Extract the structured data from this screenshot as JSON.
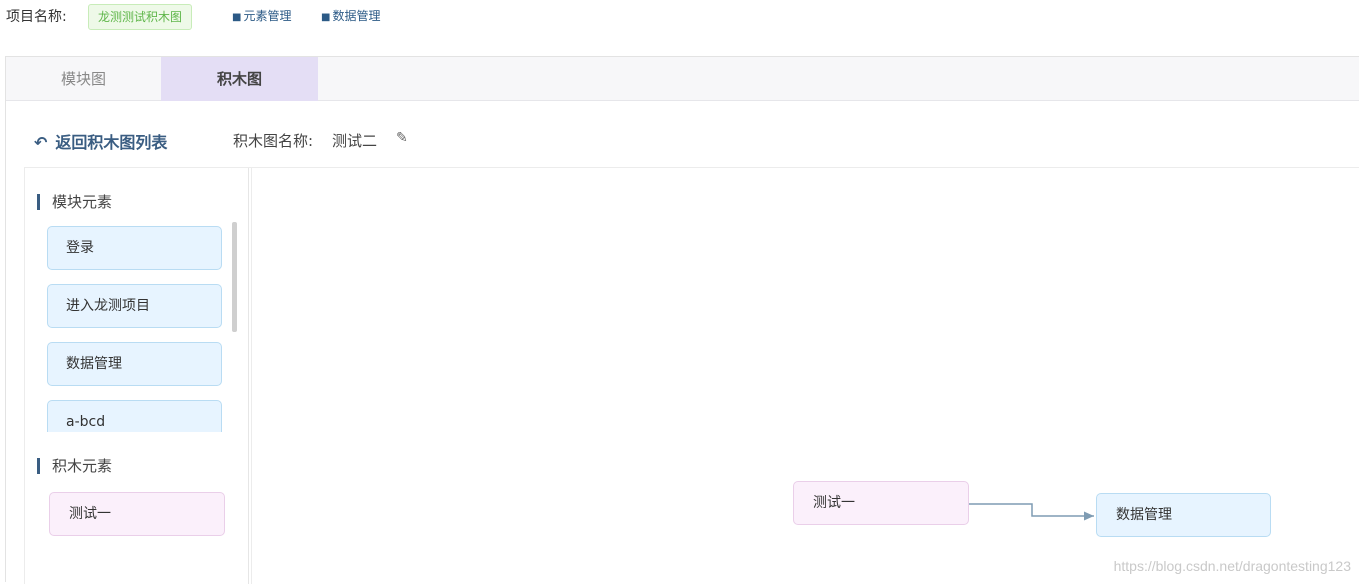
{
  "header": {
    "project_label": "项目名称:",
    "project_name": "龙测测试积木图",
    "links": [
      {
        "label": "元素管理",
        "icon": "puzzle-icon"
      },
      {
        "label": "数据管理",
        "icon": "puzzle-icon"
      }
    ]
  },
  "tabs": [
    {
      "label": "模块图",
      "active": false
    },
    {
      "label": "积木图",
      "active": true
    }
  ],
  "toolbar": {
    "back_label": "返回积木图列表",
    "name_label": "积木图名称:",
    "name_value": "测试二"
  },
  "sidebar": {
    "module_title": "模块元素",
    "modules": [
      "登录",
      "进入龙测项目",
      "数据管理",
      "a-bcd"
    ],
    "block_title": "积木元素",
    "blocks": [
      "测试一"
    ]
  },
  "canvas": {
    "nodes": [
      {
        "label": "测试一",
        "kind": "block"
      },
      {
        "label": "数据管理",
        "kind": "module"
      }
    ]
  },
  "watermark": "https://blog.csdn.net/dragontesting123",
  "colors": {
    "accent": "#3a5d82",
    "active_tab": "#e4def5",
    "module_fill": "#e7f4ff",
    "block_fill": "#fbf0fb",
    "badge_green": "#5fb64a"
  }
}
